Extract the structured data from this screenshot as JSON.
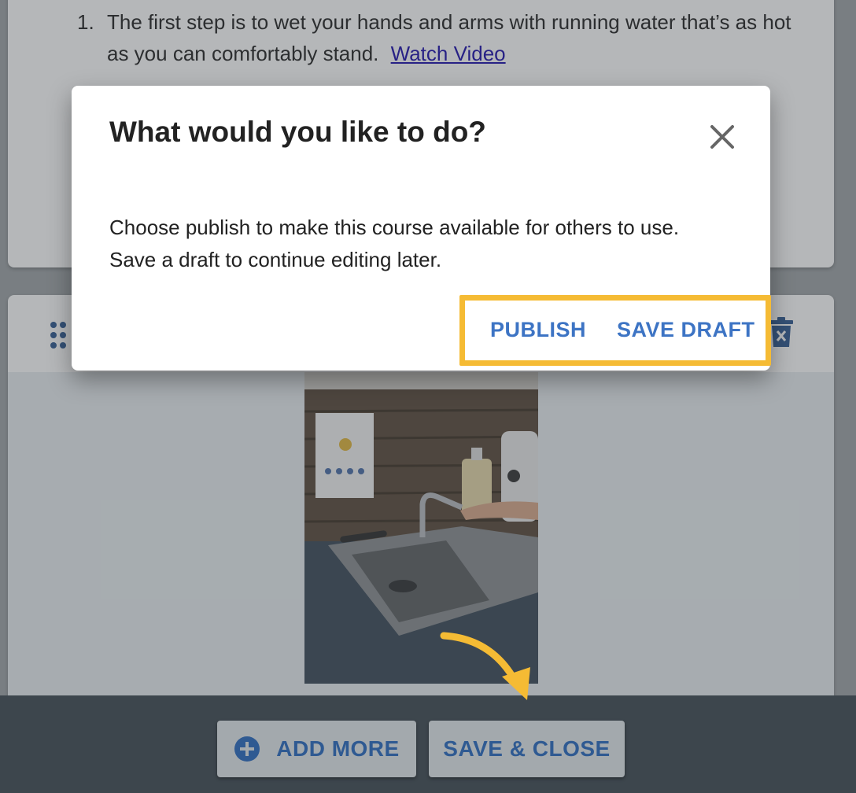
{
  "steps": {
    "items": [
      {
        "number": "1.",
        "text": "The first step is to wet your hands and arms with running water that’s as hot as you can comfortably stand.",
        "link": "Watch Video"
      }
    ]
  },
  "media_card": {
    "drag_icon": "drag-handle-icon",
    "delete_icon": "trash-icon"
  },
  "bottom_bar": {
    "add_more_label": "ADD MORE",
    "save_close_label": "SAVE & CLOSE",
    "add_icon": "plus-circle-icon"
  },
  "dialog": {
    "title": "What would you like to do?",
    "body": "Choose publish to make this course available for others to use. Save a draft to continue editing later.",
    "publish_label": "PUBLISH",
    "save_draft_label": "SAVE DRAFT",
    "close_icon": "close-icon"
  },
  "colors": {
    "accent_blue": "#3d74c4",
    "highlight_yellow": "#f5bb34",
    "bar_background": "#3d464d"
  }
}
